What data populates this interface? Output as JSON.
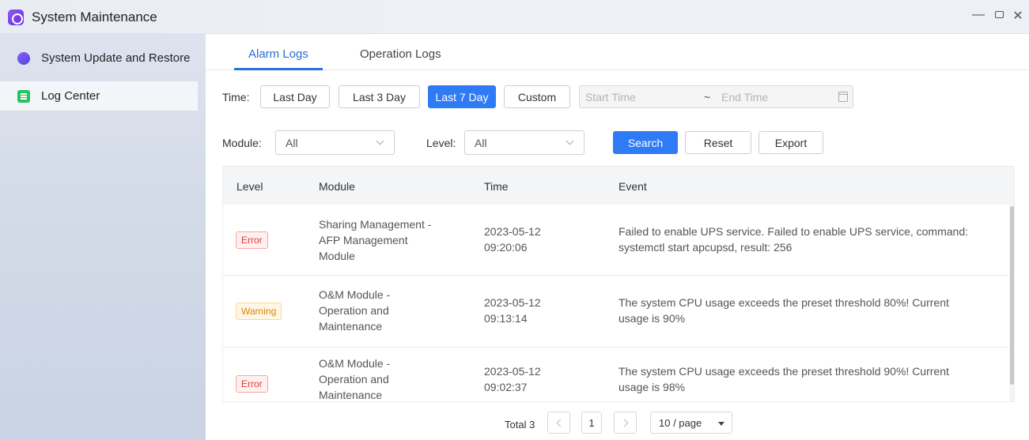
{
  "window": {
    "title": "System Maintenance",
    "minimize_label": "—",
    "close_label": "✕"
  },
  "sidebar": {
    "items": [
      {
        "label": "System Update and Restore",
        "icon": "update-icon"
      },
      {
        "label": "Log Center",
        "icon": "log-icon"
      }
    ]
  },
  "tabs": [
    {
      "label": "Alarm Logs"
    },
    {
      "label": "Operation Logs"
    }
  ],
  "filters": {
    "time_label": "Time:",
    "time_buttons": [
      "Last Day",
      "Last 3 Day",
      "Last 7 Day",
      "Custom"
    ],
    "start_placeholder": "Start Time",
    "range_sep": "~",
    "end_placeholder": "End Time",
    "module_label": "Module:",
    "module_value": "All",
    "level_label": "Level:",
    "level_value": "All",
    "search_label": "Search",
    "reset_label": "Reset",
    "export_label": "Export"
  },
  "table": {
    "headers": [
      "Level",
      "Module",
      "Time",
      "Event"
    ],
    "rows": [
      {
        "level": "Error",
        "module": [
          "Sharing Management -",
          "AFP Management",
          "Module"
        ],
        "date": "2023-05-12",
        "time": "09:20:06",
        "event": [
          "Failed to enable UPS service. Failed to enable UPS service, command:",
          "systemctl start apcupsd, result: 256"
        ]
      },
      {
        "level": "Warning",
        "module": [
          "O&M Module -",
          "Operation and",
          "Maintenance"
        ],
        "date": "2023-05-12",
        "time": "09:13:14",
        "event": [
          "The system CPU usage exceeds the preset threshold 80%!  Current",
          "usage is 90%"
        ]
      },
      {
        "level": "Error",
        "module": [
          "O&M Module -",
          "Operation and",
          "Maintenance"
        ],
        "date": "2023-05-12",
        "time": "09:02:37",
        "event": [
          "The system CPU usage exceeds the preset threshold 90%!  Current",
          "usage is 98%"
        ]
      }
    ]
  },
  "pagination": {
    "total_label": "Total 3",
    "current_page": "1",
    "page_size": "10 / page"
  },
  "colors": {
    "accent": "#2f7bf5",
    "error": "#e53935",
    "warning": "#d48806"
  }
}
